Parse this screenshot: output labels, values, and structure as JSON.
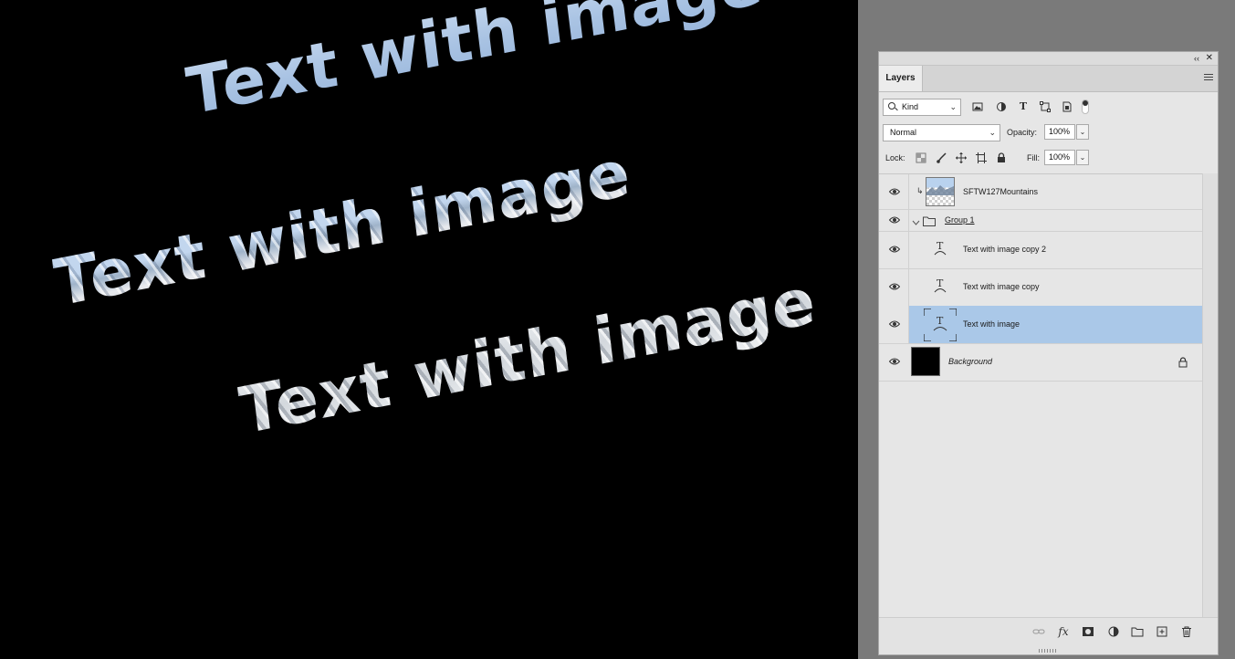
{
  "canvas": {
    "texts": [
      {
        "text": "Text with image"
      },
      {
        "text": "Text with image"
      },
      {
        "text": "Text with image"
      }
    ]
  },
  "panel": {
    "tab": "Layers",
    "filter": {
      "kind_label": "Kind",
      "icons": [
        "image-filter-icon",
        "adjustment-filter-icon",
        "type-filter-icon",
        "shape-filter-icon",
        "smart-object-filter-icon"
      ]
    },
    "blend_mode": "Normal",
    "opacity_label": "Opacity:",
    "opacity_value": "100%",
    "lock_label": "Lock:",
    "fill_label": "Fill:",
    "fill_value": "100%",
    "layers": [
      {
        "name": "SFTW127Mountains",
        "type": "clipped-image",
        "visible": true,
        "selected": false
      },
      {
        "name": "Group 1",
        "type": "group",
        "visible": true,
        "selected": false
      },
      {
        "name": "Text with image copy 2",
        "type": "warped-text",
        "visible": true,
        "selected": false
      },
      {
        "name": "Text with image copy",
        "type": "warped-text",
        "visible": true,
        "selected": false
      },
      {
        "name": "Text with image",
        "type": "warped-text",
        "visible": true,
        "selected": true
      },
      {
        "name": "Background",
        "type": "background",
        "visible": true,
        "selected": false,
        "locked": true
      }
    ],
    "bottom_icons": [
      "link-layers-icon",
      "fx-icon",
      "layer-mask-icon",
      "adjustment-layer-icon",
      "new-group-icon",
      "new-layer-icon",
      "delete-icon"
    ]
  },
  "colors": {
    "canvas_bg": "#000000",
    "workspace_bg": "#7a7a7a",
    "panel_bg": "#e6e6e6",
    "selected_row": "#aac8e8"
  }
}
